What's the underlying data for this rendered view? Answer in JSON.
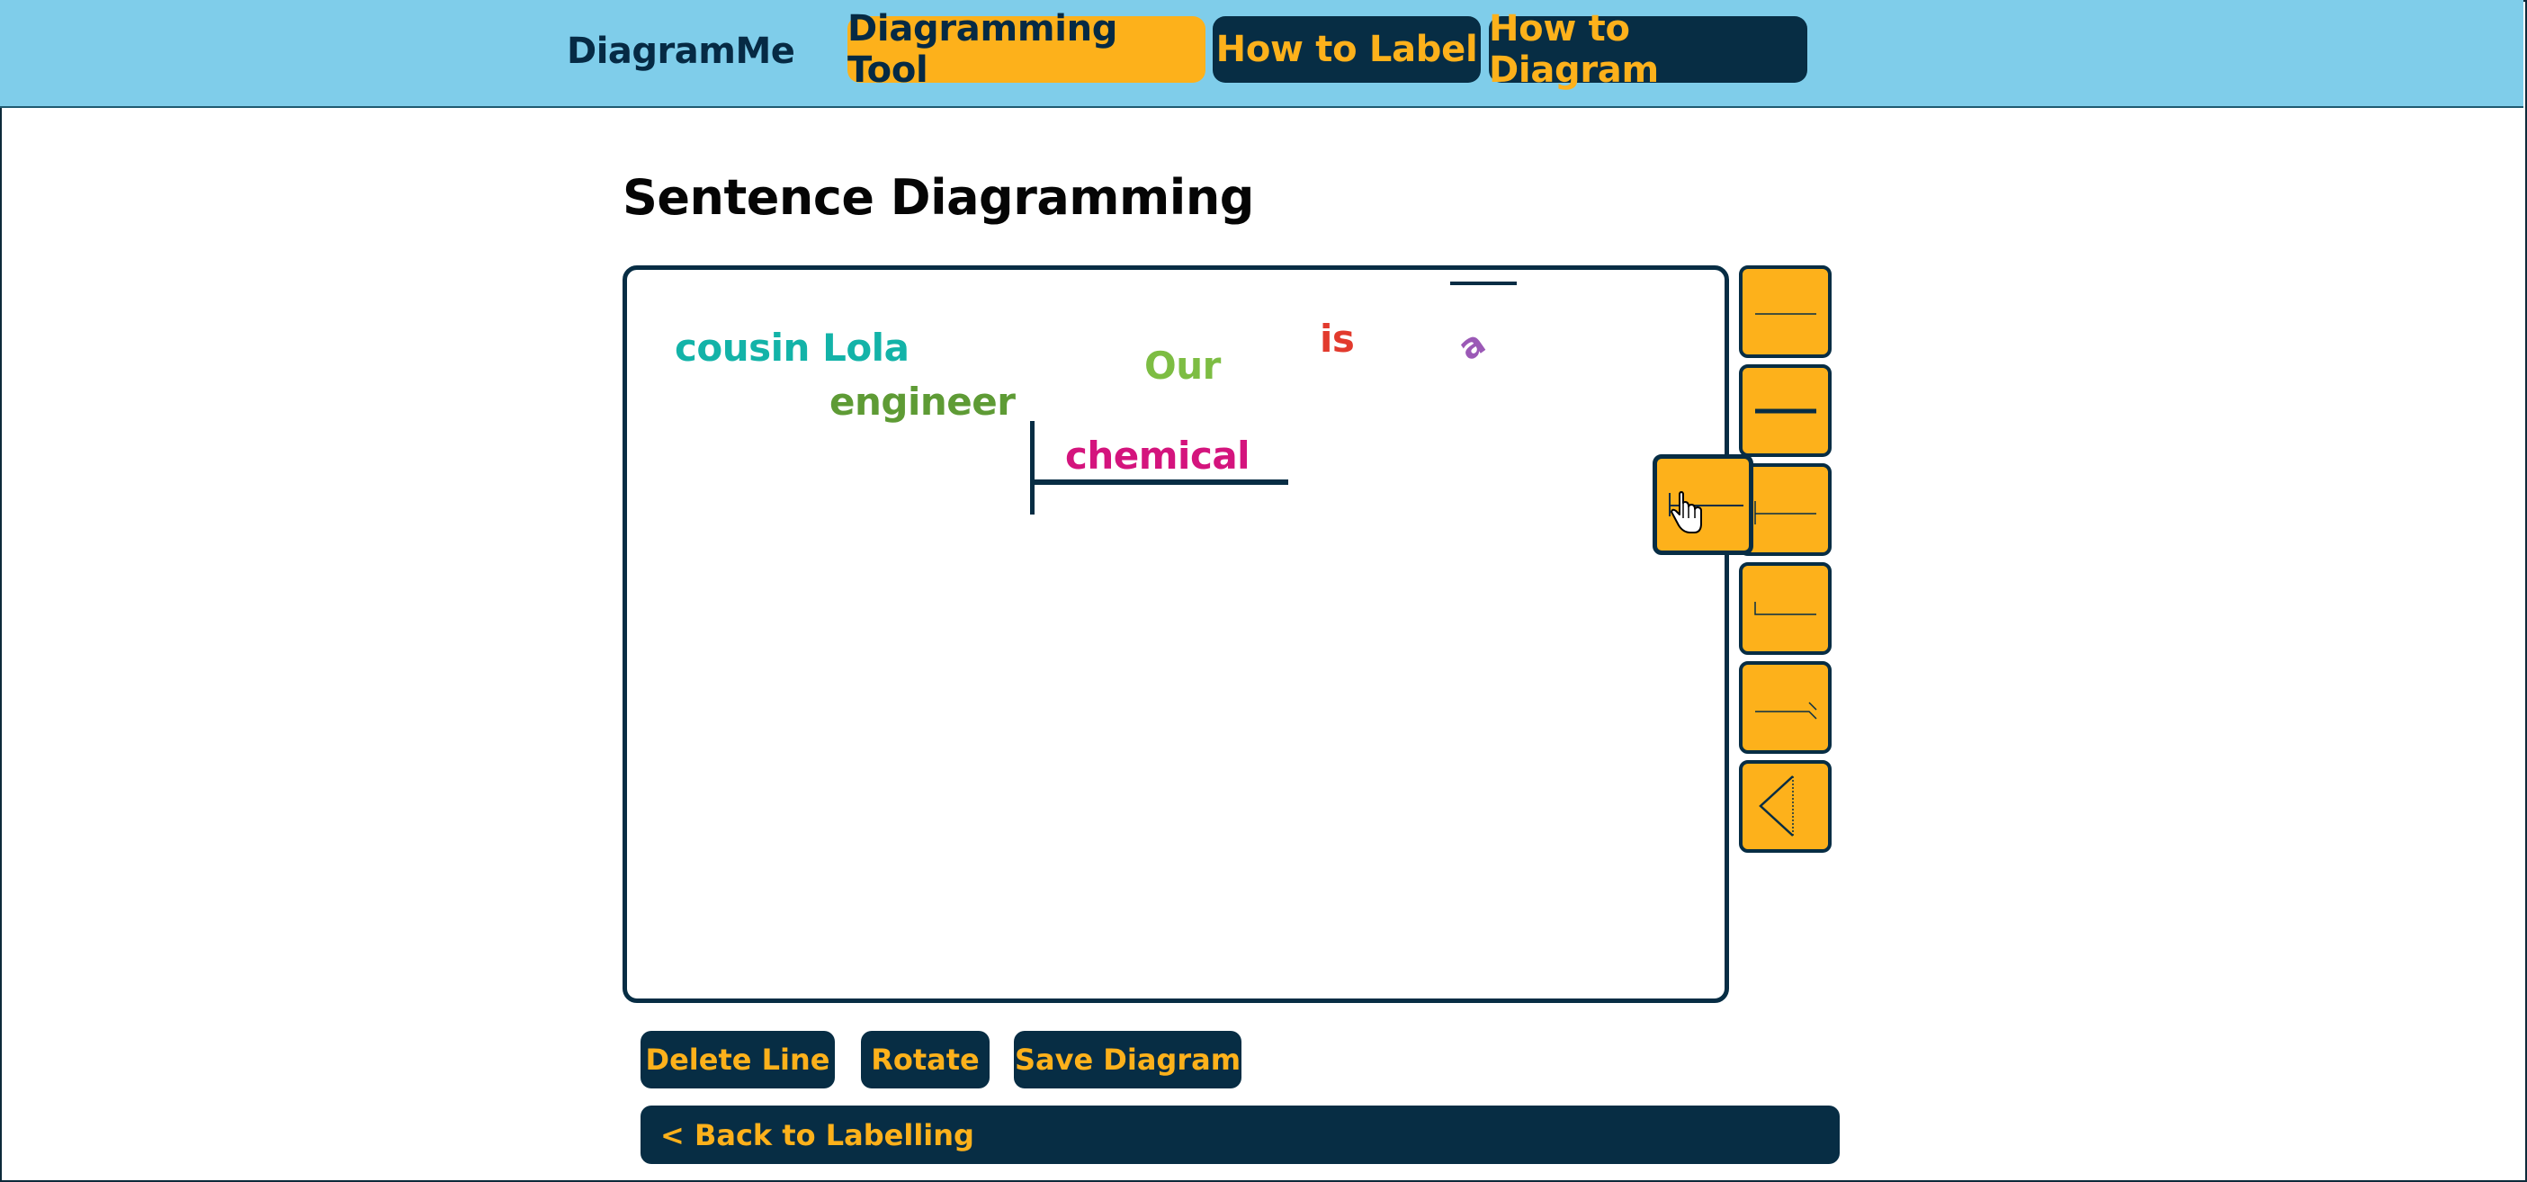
{
  "app": {
    "brand": "DiagramMe"
  },
  "nav": {
    "tabs": [
      {
        "label": "Diagramming Tool",
        "active": true
      },
      {
        "label": "How to Label",
        "active": false
      },
      {
        "label": "How to Diagram",
        "active": false
      }
    ]
  },
  "page": {
    "title": "Sentence Diagramming"
  },
  "canvas": {
    "words": [
      {
        "text": "cousin Lola",
        "color": "#13b3a8"
      },
      {
        "text": "engineer",
        "color": "#5e9b35"
      },
      {
        "text": "Our",
        "color": "#7dbd43"
      },
      {
        "text": "is",
        "color": "#e23a2d"
      },
      {
        "text": "a",
        "color": "#9b59b6"
      },
      {
        "text": "chemical",
        "color": "#d4147d"
      }
    ]
  },
  "toolbox": {
    "tools": [
      "horizontal-line-thin-icon",
      "horizontal-line-thick-icon",
      "divider-line-icon",
      "corner-line-icon",
      "slant-line-icon",
      "triangle-icon"
    ],
    "dragging": "divider-line-icon"
  },
  "actions": {
    "delete_label": "Delete Line",
    "rotate_label": "Rotate",
    "save_label": "Save Diagram",
    "back_label": "< Back to Labelling"
  },
  "colors": {
    "navy": "#072d44",
    "gold": "#fdb11b",
    "sky": "#7fcdea"
  }
}
